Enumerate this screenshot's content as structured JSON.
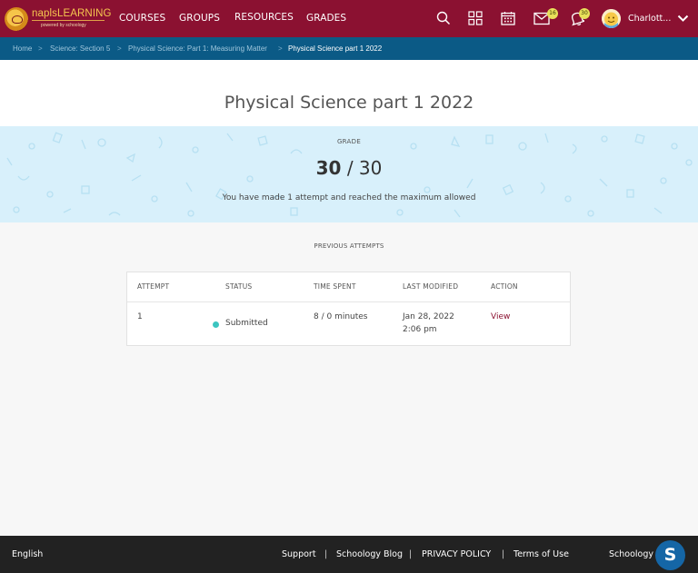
{
  "topnav": {
    "brand": "naplsLEARNING",
    "brand_sub": "powered by schoology",
    "links": [
      "COURSES",
      "GROUPS",
      "RESOURCES",
      "GRADES"
    ],
    "messages_badge": "16",
    "notifications_badge": "30",
    "user_name": "Charlott...",
    "colors": {
      "bar": "#8b1131",
      "brand": "#f5c64f",
      "badge": "#e8e05a"
    },
    "icons": [
      "search-icon",
      "apps-grid-icon",
      "calendar-icon",
      "mail-icon",
      "bell-icon",
      "chevron-down-icon"
    ]
  },
  "breadcrumb": {
    "items": [
      "Home",
      "Science: Section 5",
      "Physical Science: Part 1: Measuring Matter"
    ],
    "current": "Physical Science part 1 2022"
  },
  "page": {
    "title": "Physical Science part 1 2022",
    "grade_label": "GRADE",
    "score": "30",
    "score_sep": "/",
    "max_score": "30",
    "attempt_message": "You have made 1 attempt and reached the maximum allowed",
    "previous_attempts_label": "PREVIOUS ATTEMPTS"
  },
  "attempts_table": {
    "headers": [
      "ATTEMPT",
      "STATUS",
      "TIME SPENT",
      "LAST MODIFIED",
      "ACTION"
    ],
    "rows": [
      {
        "attempt": "1",
        "status": "Submitted",
        "time_spent": "8 / 0 minutes",
        "date": "Jan 28, 2022",
        "time": "2:06 pm",
        "action": "View"
      }
    ]
  },
  "footer": {
    "language": "English",
    "links": [
      "Support",
      "Schoology Blog",
      "PRIVACY POLICY",
      "Terms of Use"
    ],
    "copyright": "Schoology ©",
    "help_button": "S"
  }
}
